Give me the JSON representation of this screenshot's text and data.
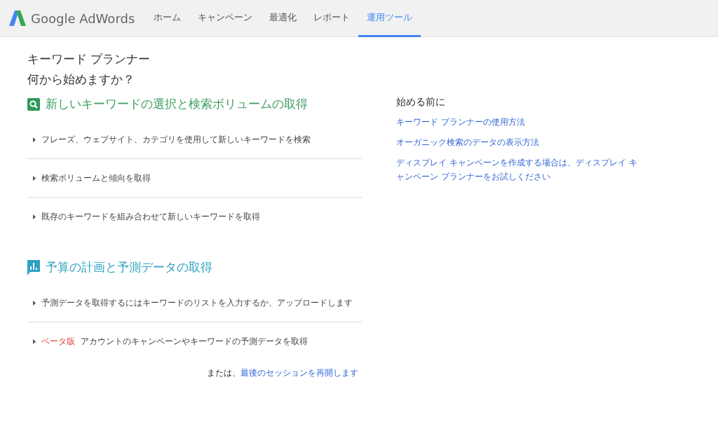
{
  "header": {
    "logo_text": "Google AdWords",
    "nav": [
      {
        "label": "ホーム",
        "selected": false
      },
      {
        "label": "キャンペーン",
        "selected": false
      },
      {
        "label": "最適化",
        "selected": false
      },
      {
        "label": "レポート",
        "selected": false
      },
      {
        "label": "運用ツール",
        "selected": true
      }
    ]
  },
  "page": {
    "title": "キーワード プランナー",
    "subtitle": "何から始めますか？"
  },
  "sections": [
    {
      "kind": "search",
      "title": "新しいキーワードの選択と検索ボリュームの取得",
      "items": [
        {
          "text": "フレーズ、ウェブサイト、カテゴリを使用して新しいキーワードを検索"
        },
        {
          "text": "検索ボリュームと傾向を取得"
        },
        {
          "text": "既存のキーワードを組み合わせて新しいキーワードを取得"
        }
      ]
    },
    {
      "kind": "chart",
      "title": "予算の計画と予測データの取得",
      "items": [
        {
          "text": "予測データを取得するにはキーワードのリストを入力するか、アップロードします"
        },
        {
          "badge": "ベータ版",
          "text": "アカウントのキャンペーンやキーワードの予測データを取得"
        }
      ]
    }
  ],
  "resume": {
    "prefix": "または、",
    "link": "最後のセッションを再開します"
  },
  "sidebar": {
    "title": "始める前に",
    "links": [
      "キーワード プランナーの使用方法",
      "オーガニック検索のデータの表示方法",
      "ディスプレイ キャンペーンを作成する場合は、ディスプレイ キャンペーン プランナーをお試しください"
    ]
  }
}
